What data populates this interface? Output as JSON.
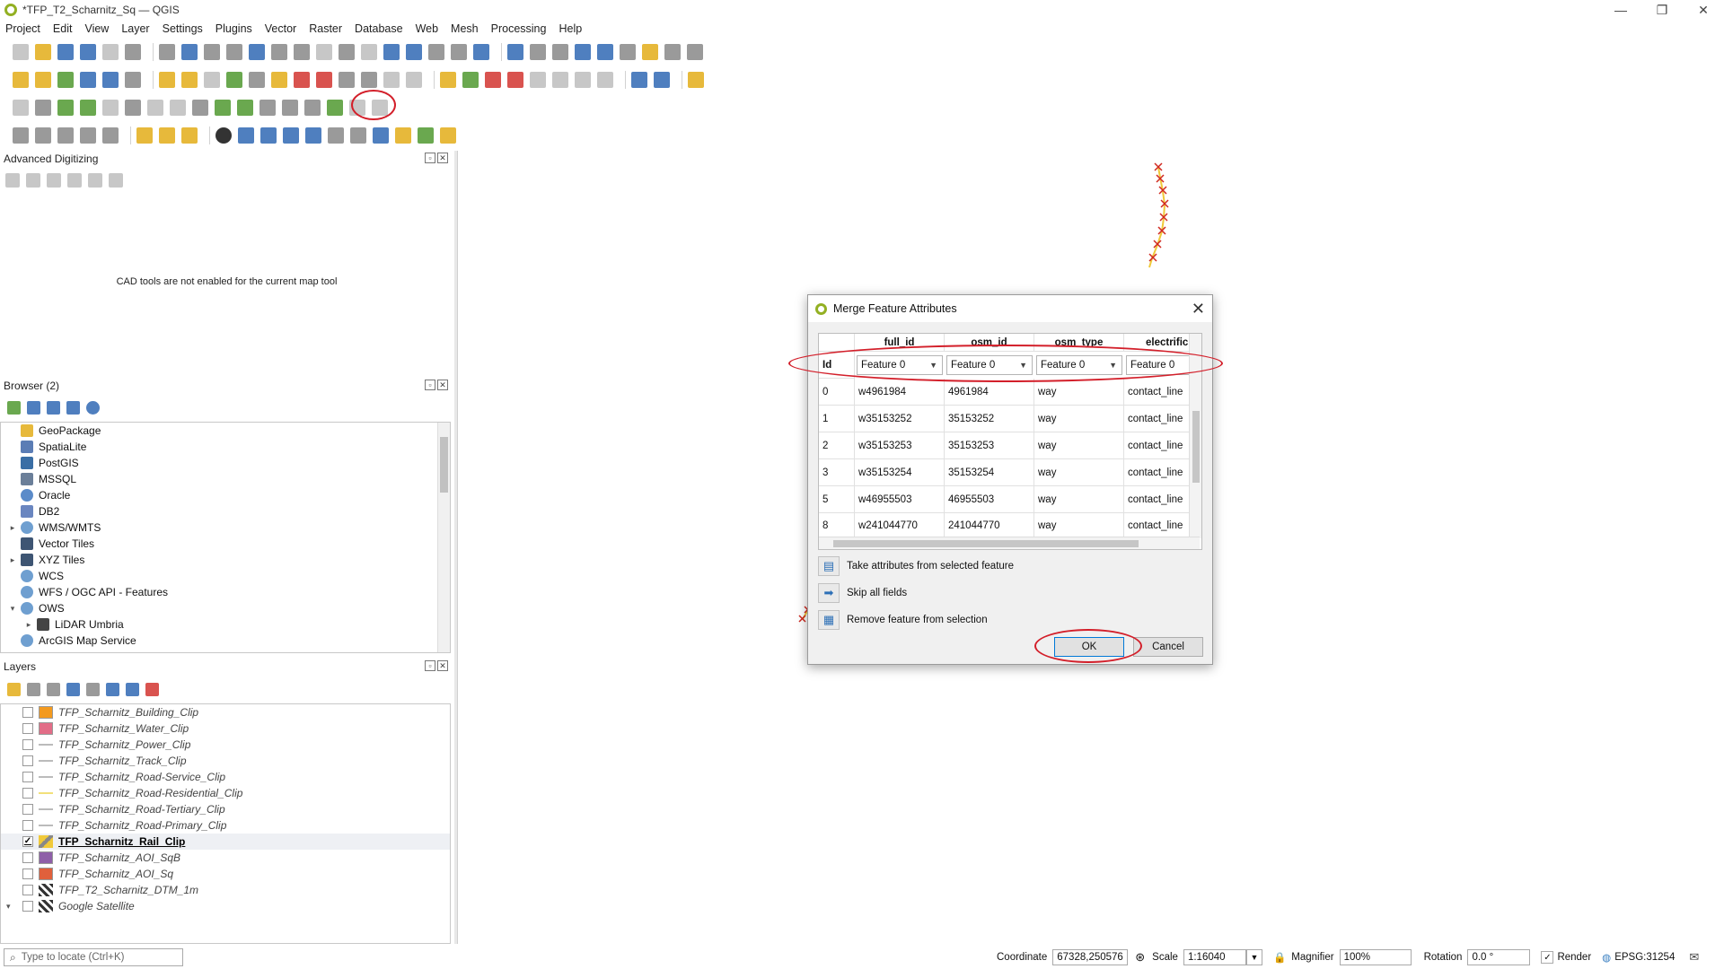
{
  "window": {
    "title": "*TFP_T2_Scharnitz_Sq — QGIS",
    "controls": [
      "—",
      "❐",
      "✕"
    ]
  },
  "menu": [
    "Project",
    "Edit",
    "View",
    "Layer",
    "Settings",
    "Plugins",
    "Vector",
    "Raster",
    "Database",
    "Web",
    "Mesh",
    "Processing",
    "Help"
  ],
  "panels": {
    "advanced_digitizing": {
      "title": "Advanced Digitizing",
      "message": "CAD tools are not enabled for the current map tool"
    },
    "browser": {
      "title": "Browser (2)",
      "items": [
        {
          "label": "GeoPackage",
          "icon": "geopackage-icon",
          "color": "#e7b93b"
        },
        {
          "label": "SpatiaLite",
          "icon": "spatialite-icon",
          "color": "#5b7db5"
        },
        {
          "label": "PostGIS",
          "icon": "postgis-icon",
          "color": "#3a6ea5"
        },
        {
          "label": "MSSQL",
          "icon": "mssql-icon",
          "color": "#6b7f99"
        },
        {
          "label": "Oracle",
          "icon": "oracle-icon",
          "color": "#5b8bc9"
        },
        {
          "label": "DB2",
          "icon": "db2-icon",
          "color": "#6a86c0"
        },
        {
          "label": "WMS/WMTS",
          "icon": "globe-icon",
          "color": "#6f9fd0",
          "expandable": "▸"
        },
        {
          "label": "Vector Tiles",
          "icon": "grid-icon",
          "color": "#3e5573"
        },
        {
          "label": "XYZ Tiles",
          "icon": "grid-icon",
          "color": "#3e5573",
          "expandable": "▸"
        },
        {
          "label": "WCS",
          "icon": "globe-icon",
          "color": "#6f9fd0"
        },
        {
          "label": "WFS / OGC API - Features",
          "icon": "globe-icon",
          "color": "#6f9fd0"
        },
        {
          "label": "OWS",
          "icon": "globe-icon",
          "color": "#6f9fd0",
          "expandable": "▾"
        },
        {
          "label": "LiDAR Umbria",
          "icon": "lidar-icon",
          "color": "#444444",
          "expandable": "▸",
          "indent": true
        },
        {
          "label": "ArcGIS Map Service",
          "icon": "globe-icon",
          "color": "#6f9fd0"
        }
      ]
    },
    "layers": {
      "title": "Layers",
      "items": [
        {
          "label": "TFP_Scharnitz_Building_Clip",
          "checked": "",
          "symbol": "fill",
          "color": "#f39a1f"
        },
        {
          "label": "TFP_Scharnitz_Water_Clip",
          "checked": "",
          "symbol": "fill",
          "color": "#e26d87"
        },
        {
          "label": "TFP_Scharnitz_Power_Clip",
          "checked": "",
          "symbol": "line",
          "color": ""
        },
        {
          "label": "TFP_Scharnitz_Track_Clip",
          "checked": "",
          "symbol": "line",
          "color": ""
        },
        {
          "label": "TFP_Scharnitz_Road-Service_Clip",
          "checked": "",
          "symbol": "line",
          "color": ""
        },
        {
          "label": "TFP_Scharnitz_Road-Residential_Clip",
          "checked": "",
          "symbol": "line-yellow",
          "color": ""
        },
        {
          "label": "TFP_Scharnitz_Road-Tertiary_Clip",
          "checked": "",
          "symbol": "line",
          "color": ""
        },
        {
          "label": "TFP_Scharnitz_Road-Primary_Clip",
          "checked": "",
          "symbol": "line",
          "color": ""
        },
        {
          "label": "TFP_Scharnitz_Rail_Clip",
          "checked": "✓",
          "symbol": "edit",
          "color": "",
          "active": true
        },
        {
          "label": "TFP_Scharnitz_AOI_SqB",
          "checked": "",
          "symbol": "fill",
          "color": "#8e5fa8"
        },
        {
          "label": "TFP_Scharnitz_AOI_Sq",
          "checked": "",
          "symbol": "fill",
          "color": "#e0603c"
        },
        {
          "label": "TFP_T2_Scharnitz_DTM_1m",
          "checked": "",
          "symbol": "grid",
          "color": ""
        },
        {
          "label": "Google Satellite",
          "checked": "",
          "symbol": "grid",
          "color": "",
          "expandable": "▾"
        }
      ]
    }
  },
  "locate": {
    "placeholder": "Type to locate (Ctrl+K)"
  },
  "status": {
    "coordinate_label": "Coordinate",
    "coordinate_value": "67328,250576",
    "scale_label": "Scale",
    "scale_value": "1:16040",
    "magnifier_label": "Magnifier",
    "magnifier_value": "100%",
    "rotation_label": "Rotation",
    "rotation_value": "0.0 °",
    "render_label": "Render",
    "render_checked": "✓",
    "crs": "EPSG:31254"
  },
  "dialog": {
    "title": "Merge Feature Attributes",
    "columns": [
      "Id",
      "full_id",
      "osm_id",
      "osm_type",
      "electrific"
    ],
    "selectors": [
      "Feature 0",
      "Feature 0",
      "Feature 0",
      "Feature 0"
    ],
    "rows": [
      {
        "id": "0",
        "full_id": "w4961984",
        "osm_id": "4961984",
        "osm_type": "way",
        "electrified": "contact_line"
      },
      {
        "id": "1",
        "full_id": "w35153252",
        "osm_id": "35153252",
        "osm_type": "way",
        "electrified": "contact_line"
      },
      {
        "id": "2",
        "full_id": "w35153253",
        "osm_id": "35153253",
        "osm_type": "way",
        "electrified": "contact_line"
      },
      {
        "id": "3",
        "full_id": "w35153254",
        "osm_id": "35153254",
        "osm_type": "way",
        "electrified": "contact_line"
      },
      {
        "id": "5",
        "full_id": "w46955503",
        "osm_id": "46955503",
        "osm_type": "way",
        "electrified": "contact_line"
      },
      {
        "id": "8",
        "full_id": "w241044770",
        "osm_id": "241044770",
        "osm_type": "way",
        "electrified": "contact_line"
      }
    ],
    "actions": {
      "take_attributes": "Take attributes from selected feature",
      "skip_all": "Skip all fields",
      "remove_feature": "Remove feature from selection"
    },
    "ok_label": "OK",
    "cancel_label": "Cancel"
  },
  "colors": {
    "highlight_ellipse": "#d31f2a",
    "rail_line": "#f0c93a",
    "vertex_marker": "#d0281f"
  }
}
